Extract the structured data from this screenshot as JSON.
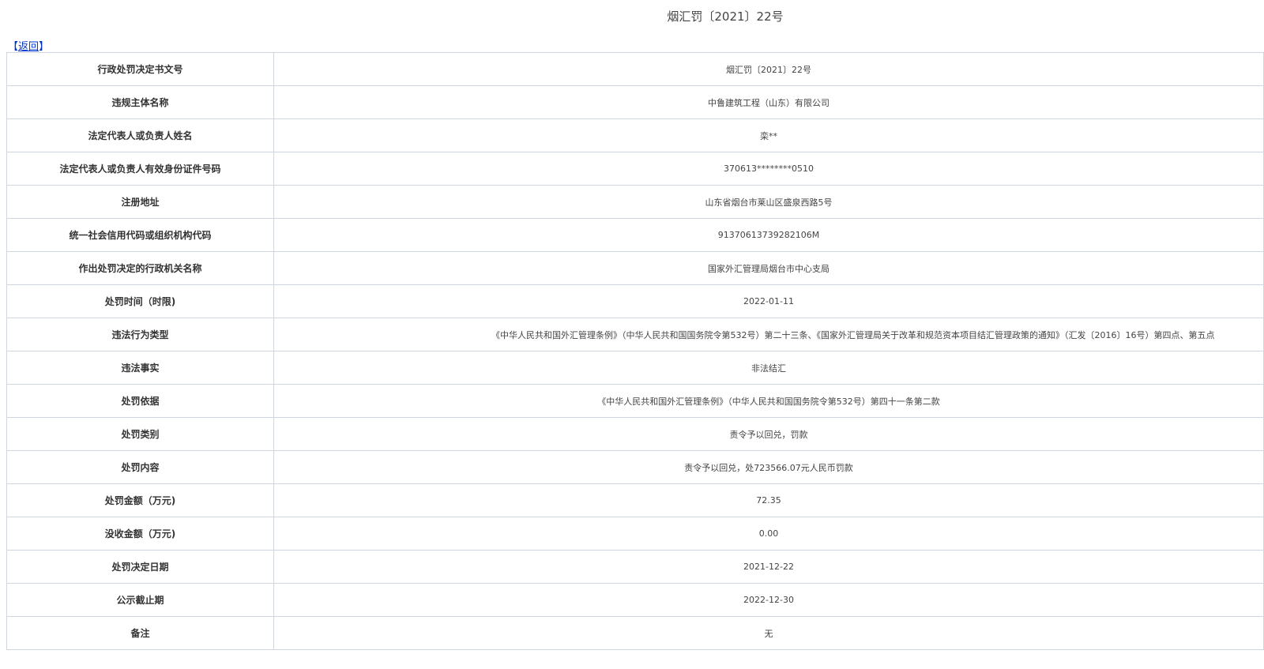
{
  "header": {
    "title": "烟汇罚〔2021〕22号"
  },
  "nav": {
    "back_open": "【",
    "back_label": "返回",
    "back_close": "】"
  },
  "table": {
    "rows": [
      {
        "label": "行政处罚决定书文号",
        "value": "烟汇罚〔2021〕22号"
      },
      {
        "label": "违规主体名称",
        "value": "中鲁建筑工程（山东）有限公司"
      },
      {
        "label": "法定代表人或负责人姓名",
        "value": "栾**"
      },
      {
        "label": "法定代表人或负责人有效身份证件号码",
        "value": "370613********0510"
      },
      {
        "label": "注册地址",
        "value": "山东省烟台市莱山区盛泉西路5号"
      },
      {
        "label": "统一社会信用代码或组织机构代码",
        "value": "91370613739282106M"
      },
      {
        "label": "作出处罚决定的行政机关名称",
        "value": "国家外汇管理局烟台市中心支局"
      },
      {
        "label": "处罚时间（时限)",
        "value": "2022-01-11"
      },
      {
        "label": "违法行为类型",
        "value": "《中华人民共和国外汇管理条例》（中华人民共和国国务院令第532号）第二十三条、《国家外汇管理局关于改革和规范资本项目结汇管理政策的通知》（汇发〔2016〕16号）第四点、第五点"
      },
      {
        "label": "违法事实",
        "value": "非法结汇"
      },
      {
        "label": "处罚依据",
        "value": "《中华人民共和国外汇管理条例》（中华人民共和国国务院令第532号）第四十一条第二款"
      },
      {
        "label": "处罚类别",
        "value": "责令予以回兑，罚款"
      },
      {
        "label": "处罚内容",
        "value": "责令予以回兑，处723566.07元人民币罚款"
      },
      {
        "label": "处罚金额（万元)",
        "value": "72.35"
      },
      {
        "label": "没收金额（万元)",
        "value": "0.00"
      },
      {
        "label": "处罚决定日期",
        "value": "2021-12-22"
      },
      {
        "label": "公示截止期",
        "value": "2022-12-30"
      },
      {
        "label": "备注",
        "value": "无"
      }
    ]
  }
}
